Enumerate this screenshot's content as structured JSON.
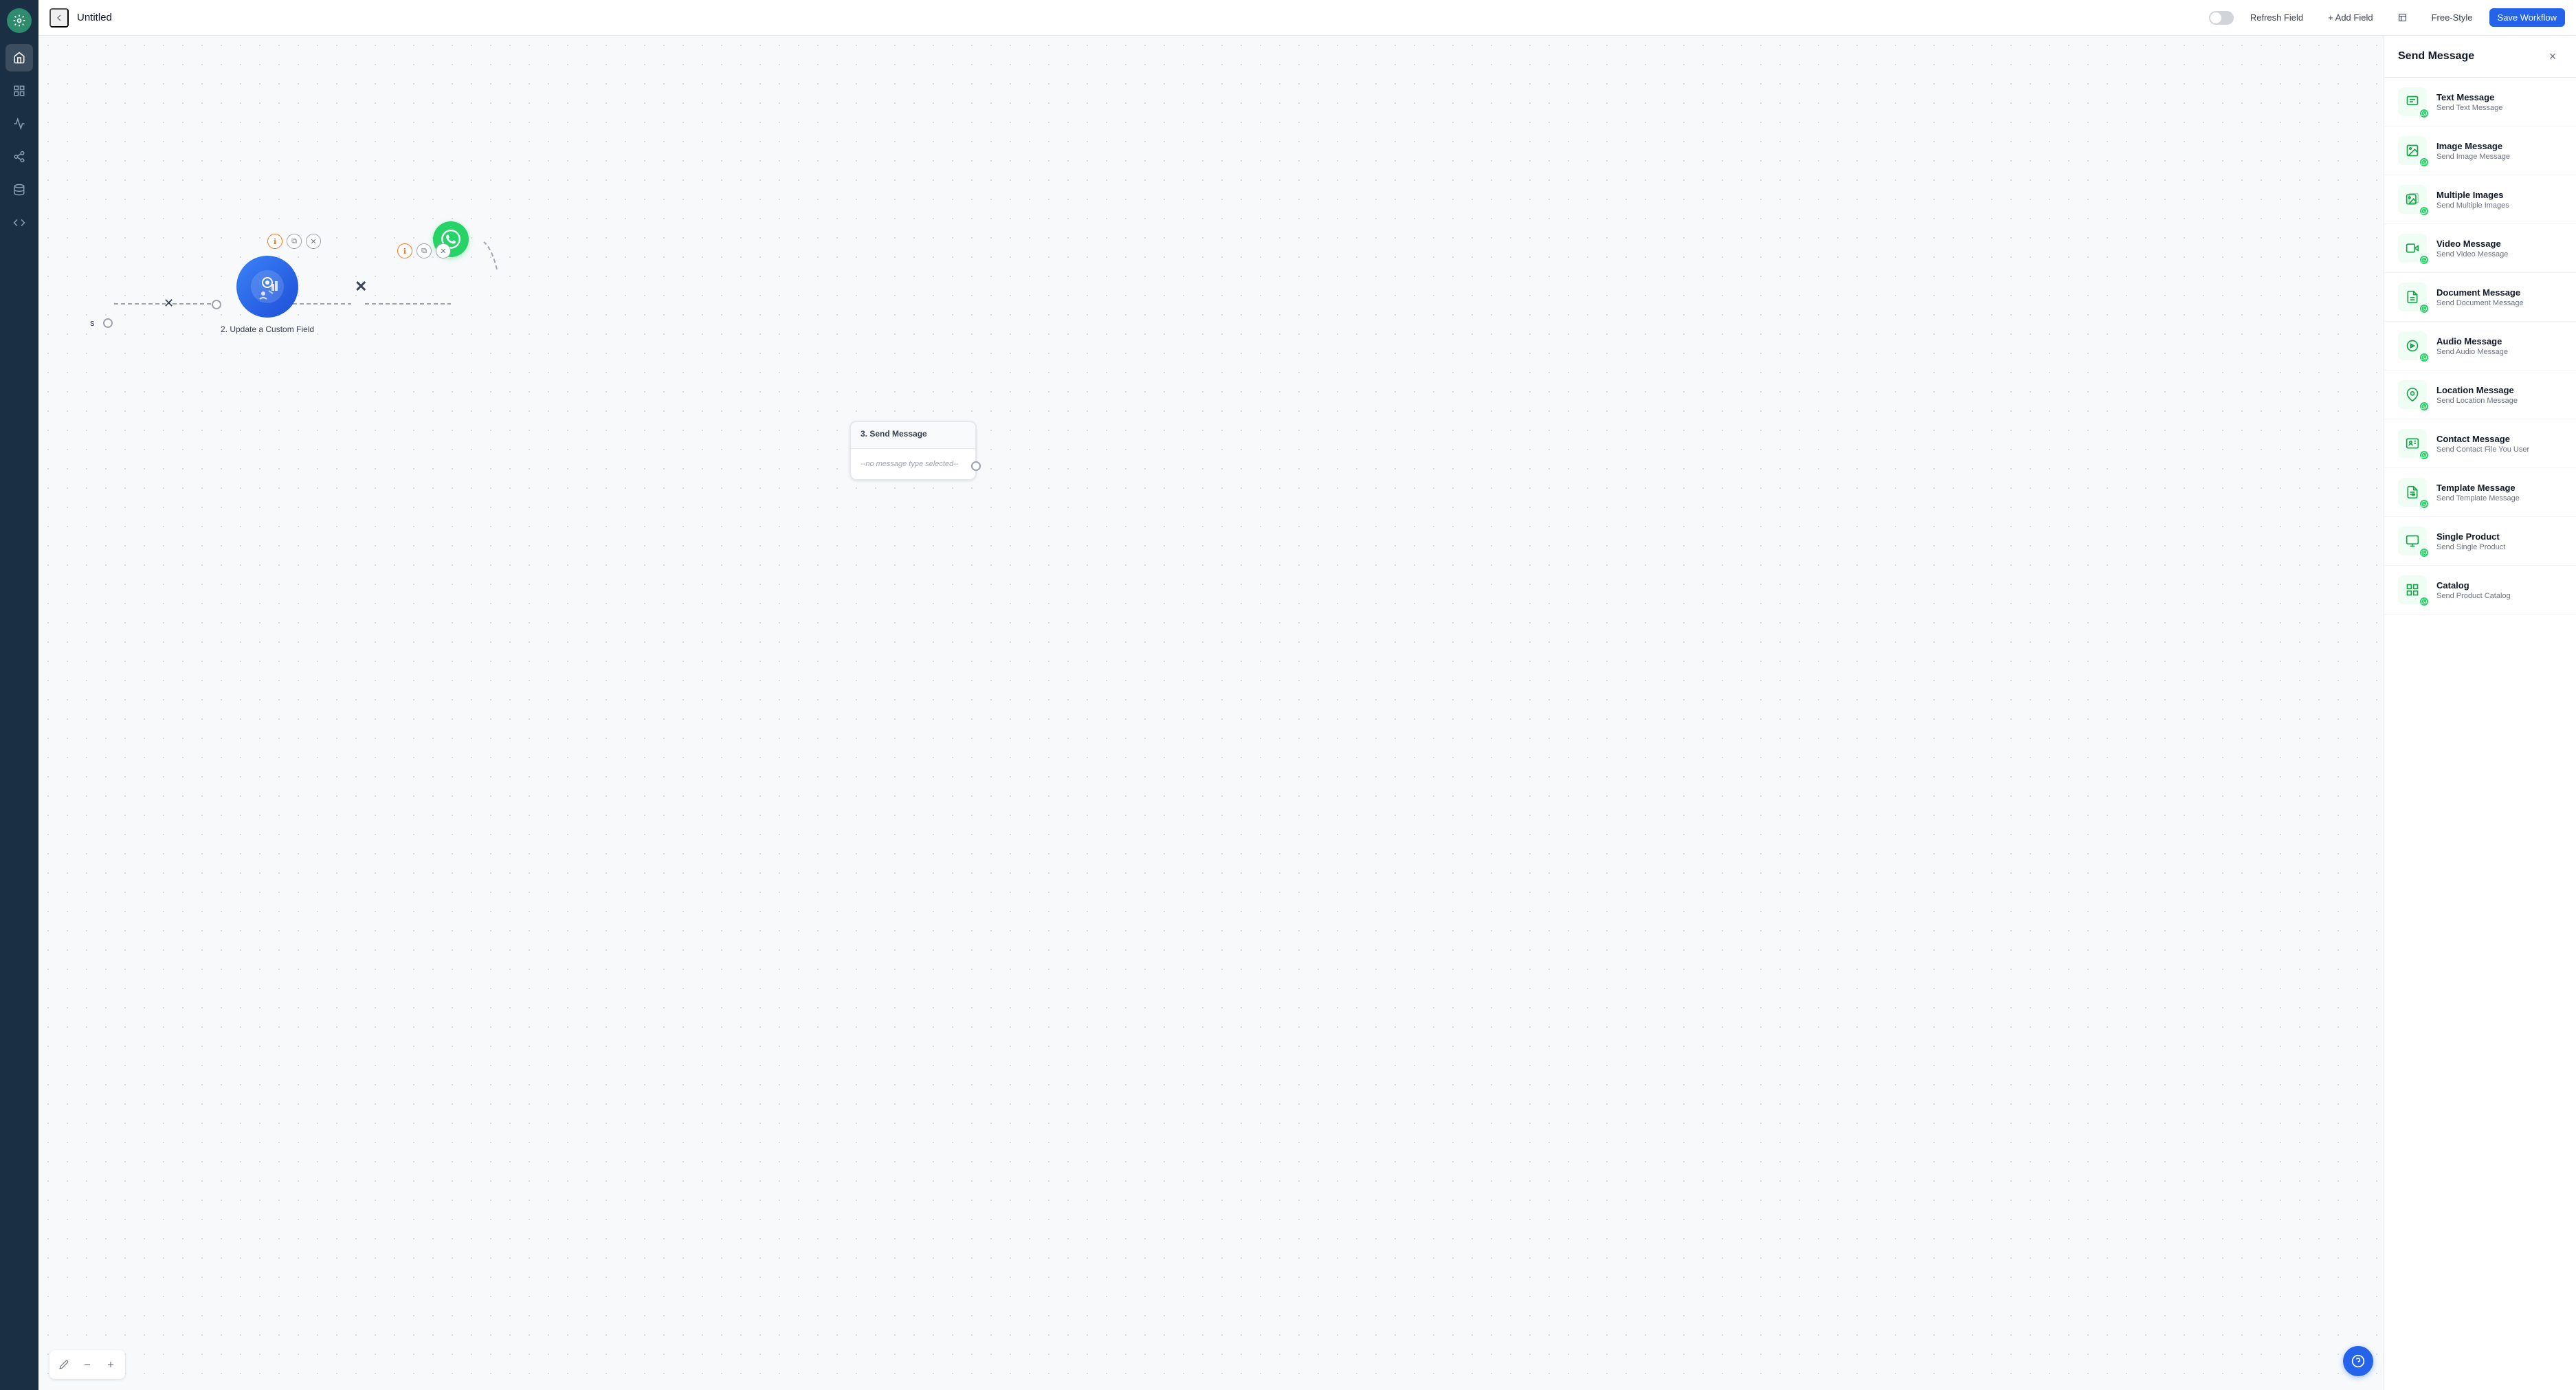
{
  "app": {
    "title": "Untitled"
  },
  "topbar": {
    "back_icon": "←",
    "title": "Untitled",
    "toggle_state": false,
    "refresh_label": "Refresh Field",
    "add_field_label": "+ Add Field",
    "freestyle_label": "Free-Style",
    "save_label": "Save Workflow"
  },
  "sidebar": {
    "items": [
      {
        "id": "home",
        "icon": "⌂",
        "active": true
      },
      {
        "id": "dashboard",
        "icon": "▣",
        "active": false
      },
      {
        "id": "analytics",
        "icon": "↗",
        "active": false
      },
      {
        "id": "share",
        "icon": "⇪",
        "active": false
      },
      {
        "id": "database",
        "icon": "⊞",
        "active": false
      },
      {
        "id": "code",
        "icon": "</>",
        "active": false
      }
    ]
  },
  "canvas": {
    "nodes": [
      {
        "id": "left-node",
        "label": "s"
      },
      {
        "id": "update-custom-field",
        "label": "2. Update a Custom Field"
      },
      {
        "id": "send-message",
        "title": "3. Send Message",
        "placeholder": "--no message type selected--"
      }
    ]
  },
  "send_message_panel": {
    "title": "Send Message",
    "close_label": "×",
    "items": [
      {
        "id": "text-message",
        "name": "Text Message",
        "desc": "Send Text Message",
        "icon": "text"
      },
      {
        "id": "image-message",
        "name": "Image Message",
        "desc": "Send Image Message",
        "icon": "image"
      },
      {
        "id": "multiple-images",
        "name": "Multiple Images",
        "desc": "Send Multiple Images",
        "icon": "multiple-images"
      },
      {
        "id": "video-message",
        "name": "Video Message",
        "desc": "Send Video Message",
        "icon": "video"
      },
      {
        "id": "document-message",
        "name": "Document Message",
        "desc": "Send Document Message",
        "icon": "document"
      },
      {
        "id": "audio-message",
        "name": "Audio Message",
        "desc": "Send Audio Message",
        "icon": "audio"
      },
      {
        "id": "location-message",
        "name": "Location Message",
        "desc": "Send Location Message",
        "icon": "location"
      },
      {
        "id": "contact-message",
        "name": "Contact Message",
        "desc": "Send Contact File You User",
        "icon": "contact"
      },
      {
        "id": "template-message",
        "name": "Template Message",
        "desc": "Send Template Message",
        "icon": "template"
      },
      {
        "id": "single-product",
        "name": "Single Product",
        "desc": "Send Single Product",
        "icon": "single-product"
      },
      {
        "id": "catalog",
        "name": "Catalog",
        "desc": "Send Product Catalog",
        "icon": "catalog"
      }
    ]
  },
  "canvas_toolbar": {
    "pencil_icon": "✏",
    "minus_icon": "−",
    "plus_icon": "+"
  }
}
